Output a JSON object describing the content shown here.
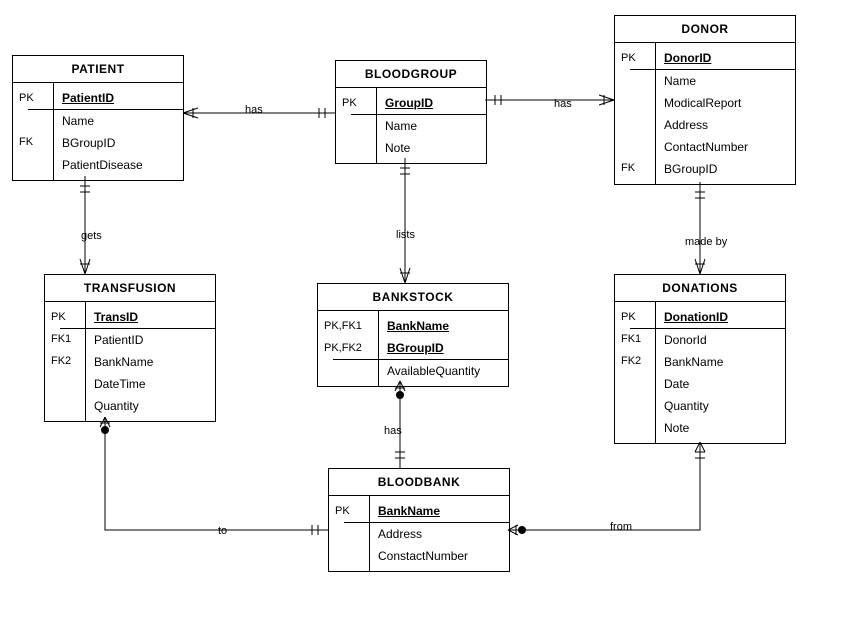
{
  "chart_data": {
    "type": "table",
    "diagram_type": "ER-diagram",
    "entities": [
      {
        "name": "PATIENT",
        "attributes": [
          {
            "key": "PK",
            "name": "PatientID",
            "pk": true
          },
          {
            "key": "",
            "name": "Name"
          },
          {
            "key": "FK",
            "name": "BGroupID"
          },
          {
            "key": "",
            "name": "PatientDisease"
          }
        ]
      },
      {
        "name": "BLOODGROUP",
        "attributes": [
          {
            "key": "PK",
            "name": "GroupID",
            "pk": true
          },
          {
            "key": "",
            "name": "Name"
          },
          {
            "key": "",
            "name": "Note"
          }
        ]
      },
      {
        "name": "DONOR",
        "attributes": [
          {
            "key": "PK",
            "name": "DonorID",
            "pk": true
          },
          {
            "key": "",
            "name": "Name"
          },
          {
            "key": "",
            "name": "ModicalReport"
          },
          {
            "key": "",
            "name": "Address"
          },
          {
            "key": "",
            "name": "ContactNumber"
          },
          {
            "key": "FK",
            "name": "BGroupID"
          }
        ]
      },
      {
        "name": "TRANSFUSION",
        "attributes": [
          {
            "key": "PK",
            "name": "TransID",
            "pk": true
          },
          {
            "key": "FK1",
            "name": "PatientID"
          },
          {
            "key": "FK2",
            "name": "BankName"
          },
          {
            "key": "",
            "name": "DateTime"
          },
          {
            "key": "",
            "name": "Quantity"
          }
        ]
      },
      {
        "name": "BANKSTOCK",
        "attributes": [
          {
            "key": "PK,FK1",
            "name": "BankName",
            "pk": true
          },
          {
            "key": "PK,FK2",
            "name": "BGroupID",
            "pk": true
          },
          {
            "key": "",
            "name": "AvailableQuantity"
          }
        ]
      },
      {
        "name": "DONATIONS",
        "attributes": [
          {
            "key": "PK",
            "name": "DonationID",
            "pk": true
          },
          {
            "key": "FK1",
            "name": "DonorId"
          },
          {
            "key": "FK2",
            "name": "BankName"
          },
          {
            "key": "",
            "name": "Date"
          },
          {
            "key": "",
            "name": "Quantity"
          },
          {
            "key": "",
            "name": "Note"
          }
        ]
      },
      {
        "name": "BLOODBANK",
        "attributes": [
          {
            "key": "PK",
            "name": "BankName",
            "pk": true
          },
          {
            "key": "",
            "name": "Address"
          },
          {
            "key": "",
            "name": "ConstactNumber"
          }
        ]
      }
    ],
    "relationships": [
      {
        "label": "has",
        "from": "PATIENT",
        "to": "BLOODGROUP"
      },
      {
        "label": "has",
        "from": "DONOR",
        "to": "BLOODGROUP"
      },
      {
        "label": "gets",
        "from": "PATIENT",
        "to": "TRANSFUSION"
      },
      {
        "label": "lists",
        "from": "BLOODGROUP",
        "to": "BANKSTOCK"
      },
      {
        "label": "made by",
        "from": "DONOR",
        "to": "DONATIONS"
      },
      {
        "label": "has",
        "from": "BLOODBANK",
        "to": "BANKSTOCK"
      },
      {
        "label": "to",
        "from": "TRANSFUSION",
        "to": "BLOODBANK"
      },
      {
        "label": "from",
        "from": "DONATIONS",
        "to": "BLOODBANK"
      }
    ]
  }
}
